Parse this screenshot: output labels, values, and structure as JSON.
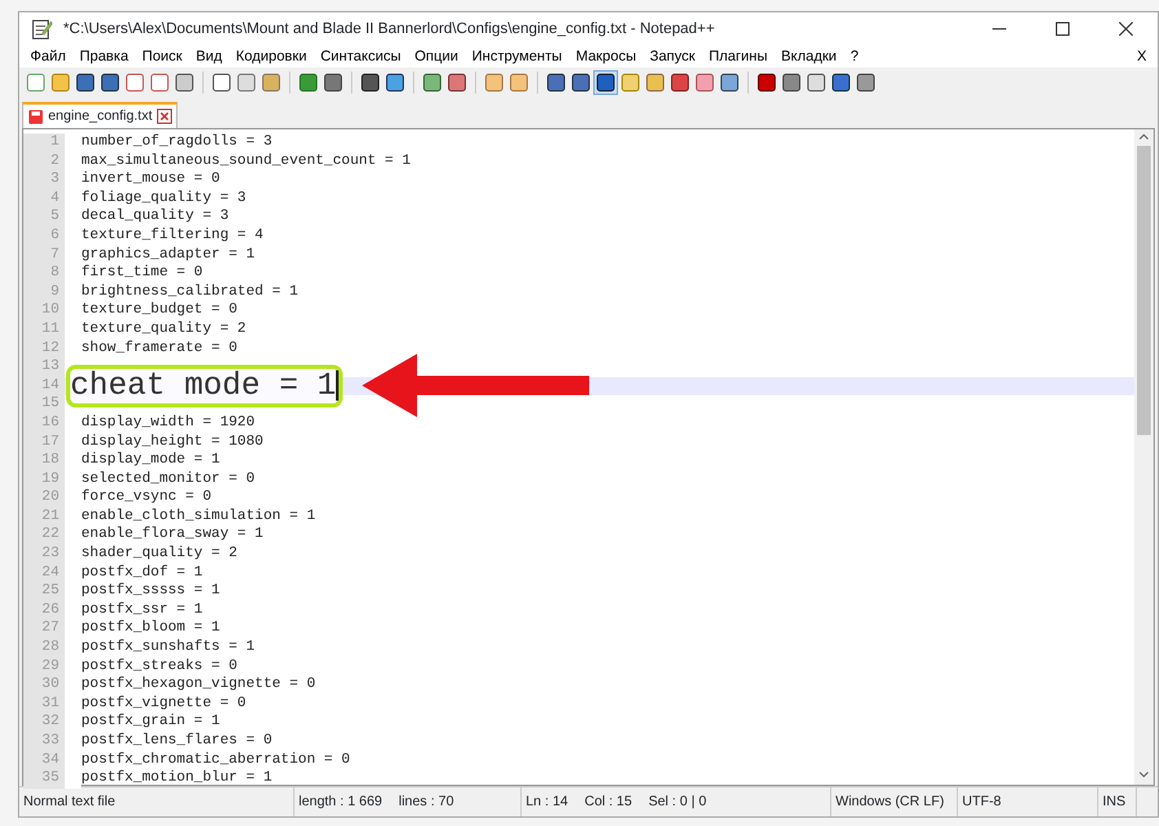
{
  "window": {
    "title": "*C:\\Users\\Alex\\Documents\\Mount and Blade II Bannerlord\\Configs\\engine_config.txt - Notepad++"
  },
  "menu": {
    "items": [
      "Файл",
      "Правка",
      "Поиск",
      "Вид",
      "Кодировки",
      "Синтаксисы",
      "Опции",
      "Инструменты",
      "Макросы",
      "Запуск",
      "Плагины",
      "Вкладки",
      "?"
    ],
    "close": "X"
  },
  "tabs": [
    {
      "label": "engine_config.txt",
      "selected": true,
      "modified": true
    }
  ],
  "editor": {
    "lines": [
      {
        "number": "1",
        "text": "number_of_ragdolls = 3"
      },
      {
        "number": "2",
        "text": "max_simultaneous_sound_event_count = 1"
      },
      {
        "number": "3",
        "text": "invert_mouse = 0"
      },
      {
        "number": "4",
        "text": "foliage_quality = 3"
      },
      {
        "number": "5",
        "text": "decal_quality = 3"
      },
      {
        "number": "6",
        "text": "texture_filtering = 4"
      },
      {
        "number": "7",
        "text": "graphics_adapter = 1"
      },
      {
        "number": "8",
        "text": "first_time = 0"
      },
      {
        "number": "9",
        "text": "brightness_calibrated = 1"
      },
      {
        "number": "10",
        "text": "texture_budget = 0"
      },
      {
        "number": "11",
        "text": "texture_quality = 2"
      },
      {
        "number": "12",
        "text": "show_framerate = 0"
      },
      {
        "number": "13"
      },
      {
        "number": "14",
        "current": true,
        "callout": "cheat mode = 1"
      },
      {
        "number": "15"
      },
      {
        "number": "16",
        "text": "display_width = 1920"
      },
      {
        "number": "17",
        "text": "display_height = 1080"
      },
      {
        "number": "18",
        "text": "display_mode = 1"
      },
      {
        "number": "19",
        "text": "selected_monitor = 0"
      },
      {
        "number": "20",
        "text": "force_vsync = 0"
      },
      {
        "number": "21",
        "text": "enable_cloth_simulation = 1"
      },
      {
        "number": "22",
        "text": "enable_flora_sway = 1"
      },
      {
        "number": "23",
        "text": "shader_quality = 2"
      },
      {
        "number": "24",
        "text": "postfx_dof = 1"
      },
      {
        "number": "25",
        "text": "postfx_sssss = 1"
      },
      {
        "number": "26",
        "text": "postfx_ssr = 1"
      },
      {
        "number": "27",
        "text": "postfx_bloom = 1"
      },
      {
        "number": "28",
        "text": "postfx_sunshafts = 1"
      },
      {
        "number": "29",
        "text": "postfx_streaks = 0"
      },
      {
        "number": "30",
        "text": "postfx_hexagon_vignette = 0"
      },
      {
        "number": "31",
        "text": "postfx_vignette = 0"
      },
      {
        "number": "32",
        "text": "postfx_grain = 1"
      },
      {
        "number": "33",
        "text": "postfx_lens_flares = 0"
      },
      {
        "number": "34",
        "text": "postfx_chromatic_aberration = 0"
      },
      {
        "number": "35",
        "text": "postfx_motion_blur = 1"
      }
    ]
  },
  "status_bar": {
    "cells": [
      {
        "texts": [
          "Normal text file"
        ]
      },
      {
        "texts": [
          "length : 1 669",
          "lines : 70"
        ]
      },
      {
        "texts": [
          "Ln : 14",
          "Col : 15",
          "Sel : 0 | 0"
        ]
      },
      {
        "texts": [
          "Windows (CR LF)"
        ]
      },
      {
        "texts": [
          "UTF-8"
        ]
      },
      {
        "texts": [
          "INS"
        ]
      }
    ]
  }
}
